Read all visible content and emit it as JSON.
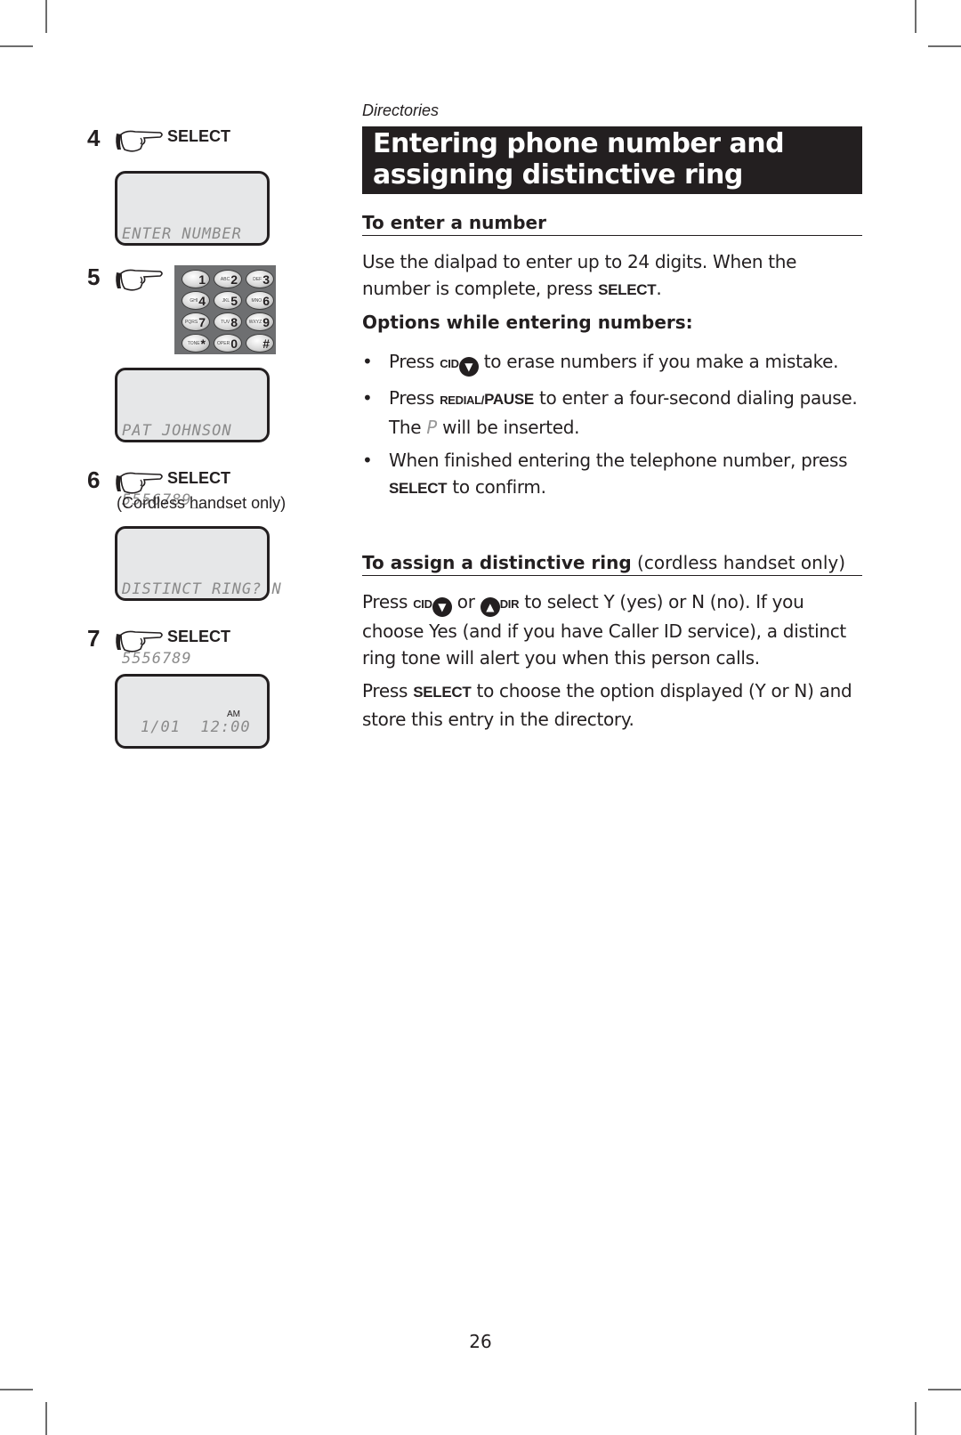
{
  "header": {
    "section": "Directories",
    "title_line1": "Entering phone number and",
    "title_line2": "assigning distinctive ring"
  },
  "steps": [
    {
      "number": "4",
      "key": "SELECT",
      "note": "",
      "lcd": [
        "ENTER NUMBER"
      ]
    },
    {
      "number": "5",
      "key": "",
      "note": "",
      "lcd": [
        "PAT JOHNSON",
        "5556789_"
      ]
    },
    {
      "number": "6",
      "key": "SELECT",
      "note": "(Cordless handset only)",
      "lcd": [
        "DISTINCT RING? N",
        "5556789"
      ]
    },
    {
      "number": "7",
      "key": "SELECT",
      "note": "",
      "lcd_clock": "1/01  12:00",
      "lcd_ampm": "AM"
    }
  ],
  "dialpad": {
    "keys": [
      {
        "letters": "",
        "digit": "1"
      },
      {
        "letters": "ABC",
        "digit": "2"
      },
      {
        "letters": "DEF",
        "digit": "3"
      },
      {
        "letters": "GHI",
        "digit": "4"
      },
      {
        "letters": "JKL",
        "digit": "5"
      },
      {
        "letters": "MNO",
        "digit": "6"
      },
      {
        "letters": "PQRS",
        "digit": "7"
      },
      {
        "letters": "TUV",
        "digit": "8"
      },
      {
        "letters": "WXYZ",
        "digit": "9"
      },
      {
        "letters": "TONE",
        "digit": "*"
      },
      {
        "letters": "OPER",
        "digit": "0"
      },
      {
        "letters": "",
        "digit": "#"
      }
    ]
  },
  "enter_number": {
    "heading": "To enter a number",
    "para_a": "Use the dialpad to enter up to 24 digits. When the number is complete, press ",
    "para_key": "SELECT",
    "para_b": ".",
    "options_heading": "Options while entering numbers:",
    "bullets": [
      {
        "pre": "Press ",
        "key": "CID",
        "icon": "down-arrow",
        "post": " to erase numbers if you make a mistake."
      },
      {
        "pre": "Press ",
        "key_small": "REDIAL/",
        "key": "PAUSE",
        "post_a": " to enter a four-second dialing pause. The ",
        "glyph": "P",
        "post_b": " will be inserted."
      },
      {
        "pre": "When finished entering the telephone number, press ",
        "key": "SELECT",
        "post": " to confirm."
      }
    ]
  },
  "distinctive_ring": {
    "heading": "To assign a distinctive ring",
    "heading_note": " (cordless handset only)",
    "para1_pre": "Press ",
    "para1_key1": "CID",
    "para1_or": " or ",
    "para1_key2": "DIR",
    "para1_post": "  to select Y (yes) or N (no). If you choose Yes (and if you have Caller ID service), a distinct ring tone will alert you when this person calls.",
    "para2_pre": "Press ",
    "para2_key": "SELECT",
    "para2_post": " to choose the option displayed (Y or N) and store this entry in the directory."
  },
  "footer": {
    "page_number": "26"
  }
}
